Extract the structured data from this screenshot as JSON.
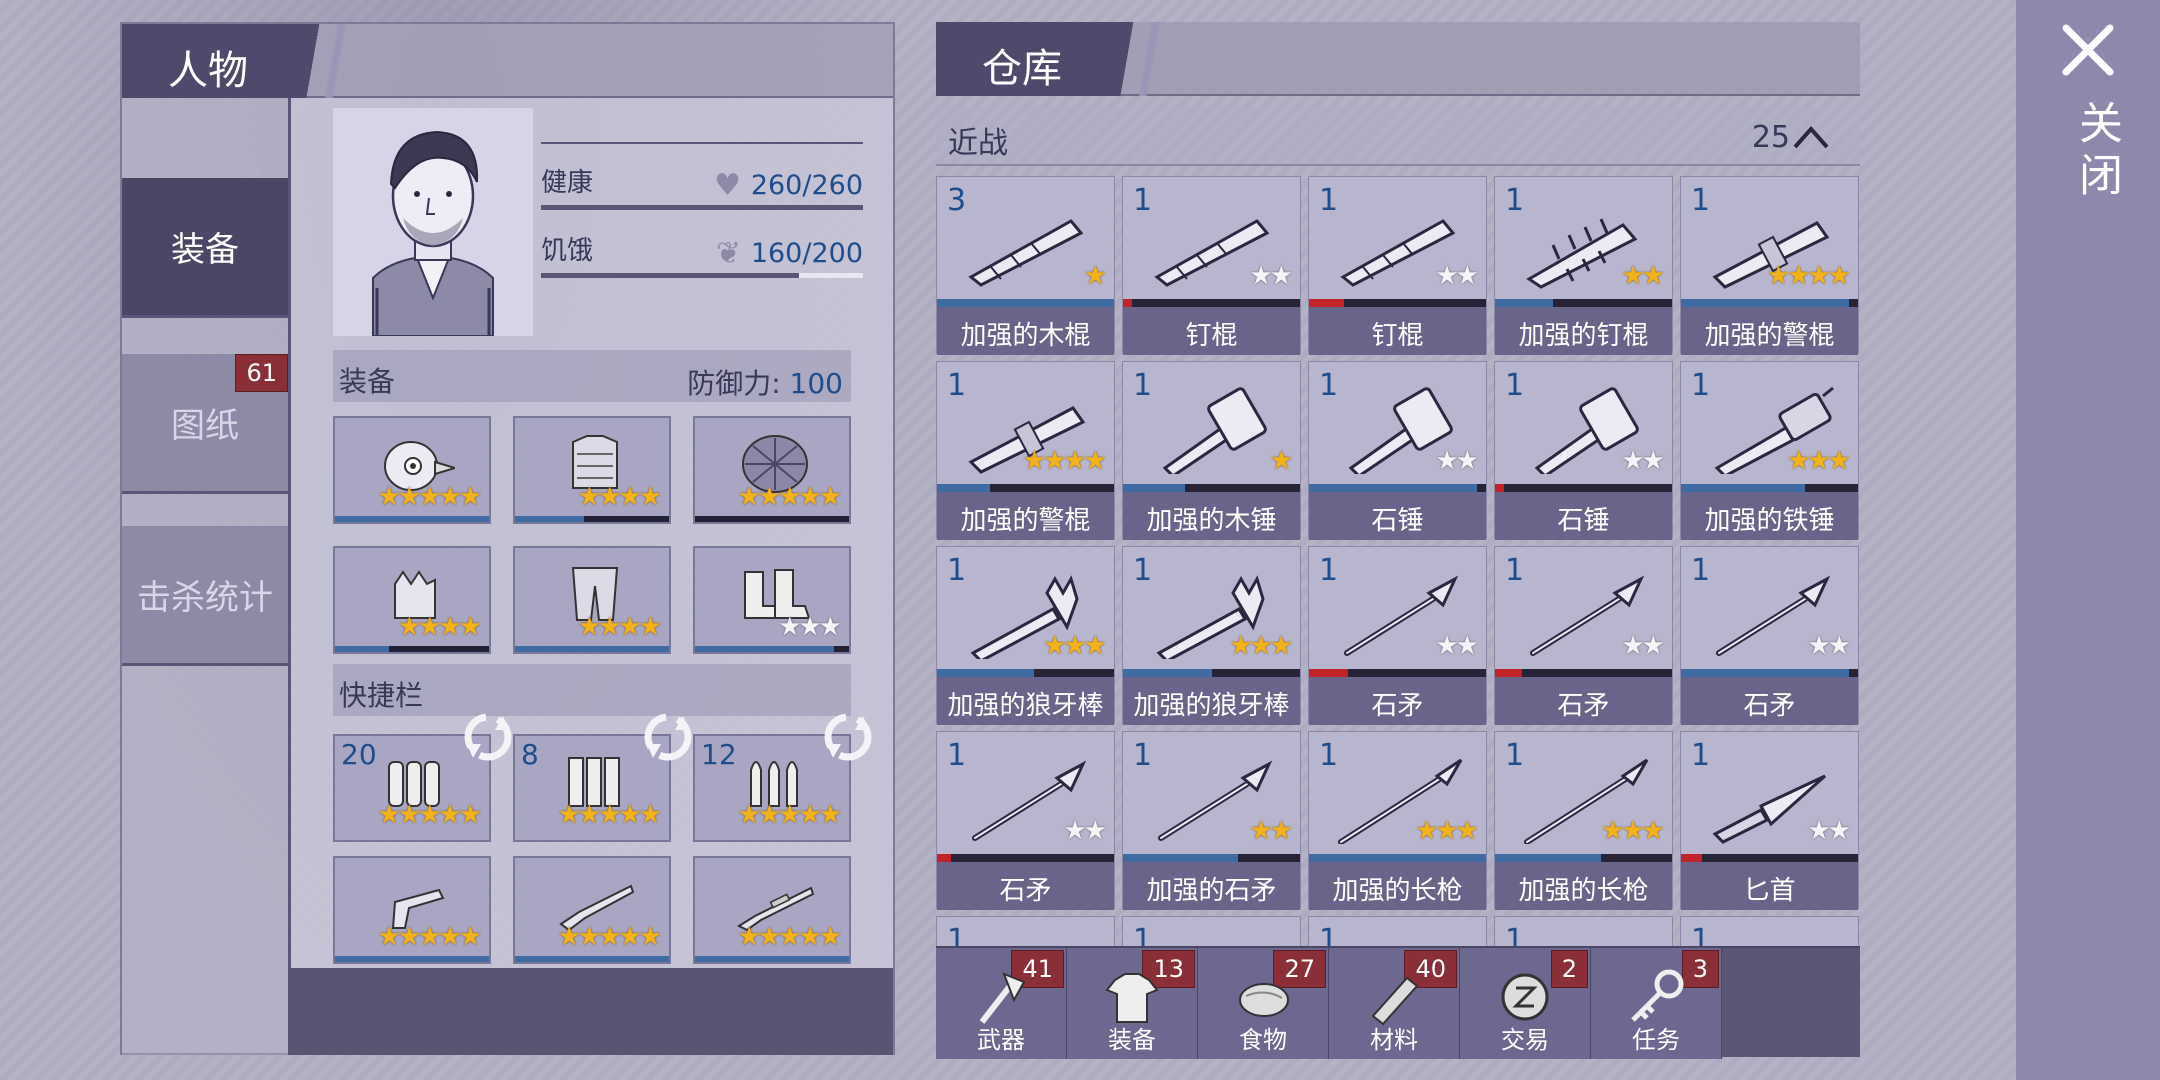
{
  "character_panel": {
    "title": "人物",
    "tabs": [
      {
        "label": "装备",
        "active": true
      },
      {
        "label": "图纸",
        "badge": "61"
      },
      {
        "label": "击杀统计"
      }
    ],
    "stats": [
      {
        "label": "健康",
        "value": "260/260",
        "fill": 1.0,
        "icon": "heart-icon"
      },
      {
        "label": "饥饿",
        "value": "160/200",
        "fill": 0.8,
        "icon": "stomach-icon"
      }
    ],
    "equipment": {
      "label": "装备",
      "defense_label": "防御力:",
      "defense_value": "100",
      "slots": [
        {
          "icon": "bird-helmet-icon",
          "stars": 5,
          "star_color": "gold",
          "durability": 1.0
        },
        {
          "icon": "body-armor-icon",
          "stars": 4,
          "star_color": "gold",
          "durability": 0.45
        },
        {
          "icon": "turtle-shell-icon",
          "stars": 5,
          "star_color": "gold",
          "durability": 0.0
        },
        {
          "icon": "gloves-icon",
          "stars": 4,
          "star_color": "gold",
          "durability": 0.35
        },
        {
          "icon": "armored-pants-icon",
          "stars": 4,
          "star_color": "gold",
          "durability": 1.0
        },
        {
          "icon": "boots-icon",
          "stars": 3,
          "star_color": "white",
          "durability": 0.9
        }
      ]
    },
    "quickbar": {
      "label": "快捷栏",
      "ammo": [
        {
          "count": "20",
          "icon": "shotgun-shells-icon",
          "stars": 5
        },
        {
          "count": "8",
          "icon": "rifle-shells-icon",
          "stars": 5
        },
        {
          "count": "12",
          "icon": "bullets-icon",
          "stars": 5
        }
      ],
      "weapons": [
        {
          "icon": "revolver-icon",
          "stars": 5
        },
        {
          "icon": "shotgun-icon",
          "stars": 5
        },
        {
          "icon": "rifle-icon",
          "stars": 5
        }
      ]
    }
  },
  "warehouse": {
    "title": "仓库",
    "category": "近战",
    "category_count": "25",
    "items": [
      {
        "count": "3",
        "name": "加强的木棍",
        "stars": 1,
        "star_color": "gold",
        "durability": 1.0,
        "bar_color": "#3f6aa2",
        "icon": "bat"
      },
      {
        "count": "1",
        "name": "钉棍",
        "stars": 2,
        "star_color": "white",
        "durability": 0.05,
        "bar_color": "#c0242a",
        "icon": "bat"
      },
      {
        "count": "1",
        "name": "钉棍",
        "stars": 2,
        "star_color": "white",
        "durability": 0.2,
        "bar_color": "#c0242a",
        "icon": "bat"
      },
      {
        "count": "1",
        "name": "加强的钉棍",
        "stars": 2,
        "star_color": "gold",
        "durability": 0.33,
        "bar_color": "#3f6aa2",
        "icon": "spiked"
      },
      {
        "count": "1",
        "name": "加强的警棍",
        "stars": 4,
        "star_color": "gold",
        "durability": 0.95,
        "bar_color": "#3f6aa2",
        "icon": "baton"
      },
      {
        "count": "1",
        "name": "加强的警棍",
        "stars": 4,
        "star_color": "gold",
        "durability": 0.3,
        "bar_color": "#3f6aa2",
        "icon": "baton"
      },
      {
        "count": "1",
        "name": "加强的木锤",
        "stars": 1,
        "star_color": "gold",
        "durability": 0.35,
        "bar_color": "#3f6aa2",
        "icon": "hammer"
      },
      {
        "count": "1",
        "name": "石锤",
        "stars": 2,
        "star_color": "white",
        "durability": 0.95,
        "bar_color": "#3f6aa2",
        "icon": "hammer"
      },
      {
        "count": "1",
        "name": "石锤",
        "stars": 2,
        "star_color": "white",
        "durability": 0.05,
        "bar_color": "#c0242a",
        "icon": "hammer"
      },
      {
        "count": "1",
        "name": "加强的铁锤",
        "stars": 3,
        "star_color": "gold",
        "durability": 0.7,
        "bar_color": "#3f6aa2",
        "icon": "sledge"
      },
      {
        "count": "1",
        "name": "加强的狼牙棒",
        "stars": 3,
        "star_color": "gold",
        "durability": 0.55,
        "bar_color": "#3f6aa2",
        "icon": "mace"
      },
      {
        "count": "1",
        "name": "加强的狼牙棒",
        "stars": 3,
        "star_color": "gold",
        "durability": 0.5,
        "bar_color": "#3f6aa2",
        "icon": "mace"
      },
      {
        "count": "1",
        "name": "石矛",
        "stars": 2,
        "star_color": "white",
        "durability": 0.22,
        "bar_color": "#c0242a",
        "icon": "spear"
      },
      {
        "count": "1",
        "name": "石矛",
        "stars": 2,
        "star_color": "white",
        "durability": 0.15,
        "bar_color": "#c0242a",
        "icon": "spear"
      },
      {
        "count": "1",
        "name": "石矛",
        "stars": 2,
        "star_color": "white",
        "durability": 0.95,
        "bar_color": "#3f6aa2",
        "icon": "spear"
      },
      {
        "count": "1",
        "name": "石矛",
        "stars": 2,
        "star_color": "white",
        "durability": 0.08,
        "bar_color": "#c0242a",
        "icon": "spear"
      },
      {
        "count": "1",
        "name": "加强的石矛",
        "stars": 2,
        "star_color": "gold",
        "durability": 0.65,
        "bar_color": "#3f6aa2",
        "icon": "spear"
      },
      {
        "count": "1",
        "name": "加强的长枪",
        "stars": 3,
        "star_color": "gold",
        "durability": 1.0,
        "bar_color": "#3f6aa2",
        "icon": "lance"
      },
      {
        "count": "1",
        "name": "加强的长枪",
        "stars": 3,
        "star_color": "gold",
        "durability": 0.6,
        "bar_color": "#3f6aa2",
        "icon": "lance"
      },
      {
        "count": "1",
        "name": "匕首",
        "stars": 2,
        "star_color": "white",
        "durability": 0.12,
        "bar_color": "#c0242a",
        "icon": "knife"
      },
      {
        "count": "1",
        "name": "",
        "stars": 0,
        "star_color": "gold",
        "durability": 0.0,
        "bar_color": "#3f6aa2",
        "icon": "none"
      },
      {
        "count": "1",
        "name": "",
        "stars": 0,
        "star_color": "gold",
        "durability": 0.0,
        "bar_color": "#3f6aa2",
        "icon": "none"
      },
      {
        "count": "1",
        "name": "",
        "stars": 0,
        "star_color": "gold",
        "durability": 0.0,
        "bar_color": "#3f6aa2",
        "icon": "none"
      },
      {
        "count": "1",
        "name": "",
        "stars": 0,
        "star_color": "gold",
        "durability": 0.0,
        "bar_color": "#3f6aa2",
        "icon": "none"
      },
      {
        "count": "1",
        "name": "",
        "stars": 0,
        "star_color": "gold",
        "durability": 0.0,
        "bar_color": "#3f6aa2",
        "icon": "none"
      }
    ],
    "category_tabs": [
      {
        "label": "武器",
        "badge": "41",
        "icon": "axe-icon"
      },
      {
        "label": "装备",
        "badge": "13",
        "icon": "shirt-icon"
      },
      {
        "label": "食物",
        "badge": "27",
        "icon": "meat-icon"
      },
      {
        "label": "材料",
        "badge": "40",
        "icon": "wood-icon"
      },
      {
        "label": "交易",
        "badge": "2",
        "icon": "coin-icon"
      },
      {
        "label": "任务",
        "badge": "3",
        "icon": "key-icon"
      }
    ]
  },
  "close": {
    "label": "关闭"
  }
}
